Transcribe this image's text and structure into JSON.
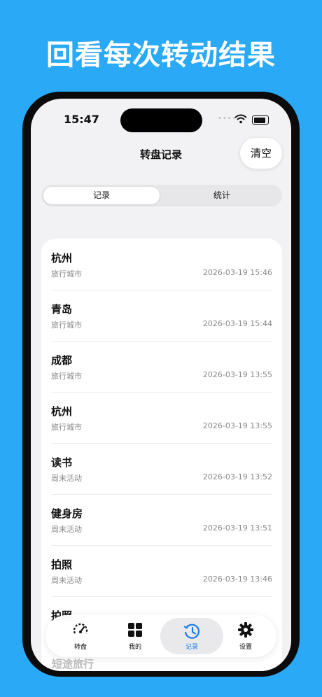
{
  "promo": {
    "headline": "回看每次转动结果"
  },
  "status": {
    "time": "15:47"
  },
  "nav": {
    "title": "转盘记录",
    "clear_label": "清空"
  },
  "segments": [
    {
      "label": "记录",
      "selected": true
    },
    {
      "label": "统计",
      "selected": false
    }
  ],
  "records": [
    {
      "title": "杭州",
      "category": "旅行城市",
      "datetime": "2026-03-19 15:46"
    },
    {
      "title": "青岛",
      "category": "旅行城市",
      "datetime": "2026-03-19 15:44"
    },
    {
      "title": "成都",
      "category": "旅行城市",
      "datetime": "2026-03-19 13:55"
    },
    {
      "title": "杭州",
      "category": "旅行城市",
      "datetime": "2026-03-19 13:55"
    },
    {
      "title": "读书",
      "category": "周末活动",
      "datetime": "2026-03-19 13:52"
    },
    {
      "title": "健身房",
      "category": "周末活动",
      "datetime": "2026-03-19 13:51"
    },
    {
      "title": "拍照",
      "category": "周末活动",
      "datetime": "2026-03-19 13:46"
    }
  ],
  "partial_row_title": "拍照",
  "below_card_text": "短途旅行",
  "tabbar": [
    {
      "label": "转盘",
      "icon": "dial-icon",
      "active": false
    },
    {
      "label": "我的",
      "icon": "grid-icon",
      "active": false
    },
    {
      "label": "记录",
      "icon": "history-icon",
      "active": true
    },
    {
      "label": "设置",
      "icon": "gear-icon",
      "active": false
    }
  ],
  "colors": {
    "background": "#2aa9f7",
    "accent": "#1a7de8"
  }
}
